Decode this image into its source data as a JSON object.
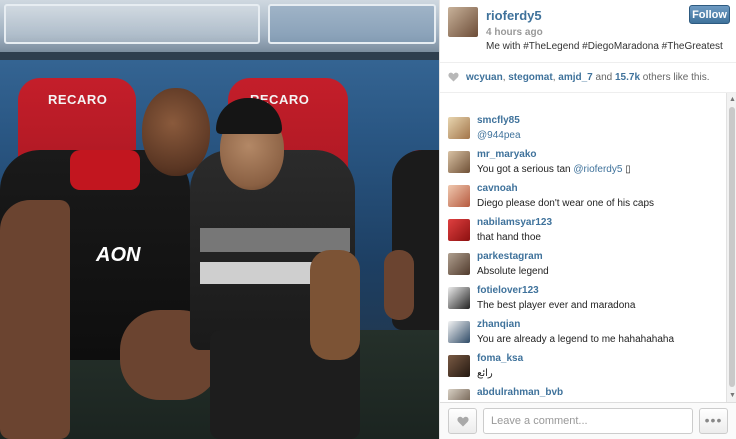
{
  "photo": {
    "seat_left_label": "RECARO",
    "seat_right_label": "RECARO",
    "shirt_sponsor": "AON"
  },
  "post": {
    "owner": "rioferdy5",
    "time": "4 hours ago",
    "caption": "Me with #TheLegend #DiegoMaradona #TheGreatest",
    "follow_label": "Follow"
  },
  "likes": {
    "users": [
      "wcyuan",
      "stegomat",
      "amjd_7"
    ],
    "sep": ", ",
    "and": " and ",
    "others_count": "15.7k",
    "others_suffix": " others like this."
  },
  "comments": [
    {
      "user": "smcfly85",
      "text": "",
      "mention": "@944pea"
    },
    {
      "user": "mr_maryako",
      "text": "You got a serious tan ",
      "mention": "@rioferdy5",
      "suffix": " ▯"
    },
    {
      "user": "cavnoah",
      "text": "Diego please don't wear one of his caps"
    },
    {
      "user": "nabilamsyar123",
      "text": "that hand thoe"
    },
    {
      "user": "parkestagram",
      "text": "Absolute legend"
    },
    {
      "user": "fotielover123",
      "text": "The best player ever and maradona"
    },
    {
      "user": "zhanqian",
      "text": "You are already a legend to me hahahahaha"
    },
    {
      "user": "foma_ksa",
      "text": "رائع"
    },
    {
      "user": "abdulrahman_bvb",
      "text": ""
    }
  ],
  "footer": {
    "comment_placeholder": "Leave a comment...",
    "more_label": "•••"
  },
  "icons": {
    "heart": "heart-icon",
    "more": "more-options-icon"
  },
  "colors": {
    "link": "#3f729b",
    "follow_button": "#3f729b"
  }
}
